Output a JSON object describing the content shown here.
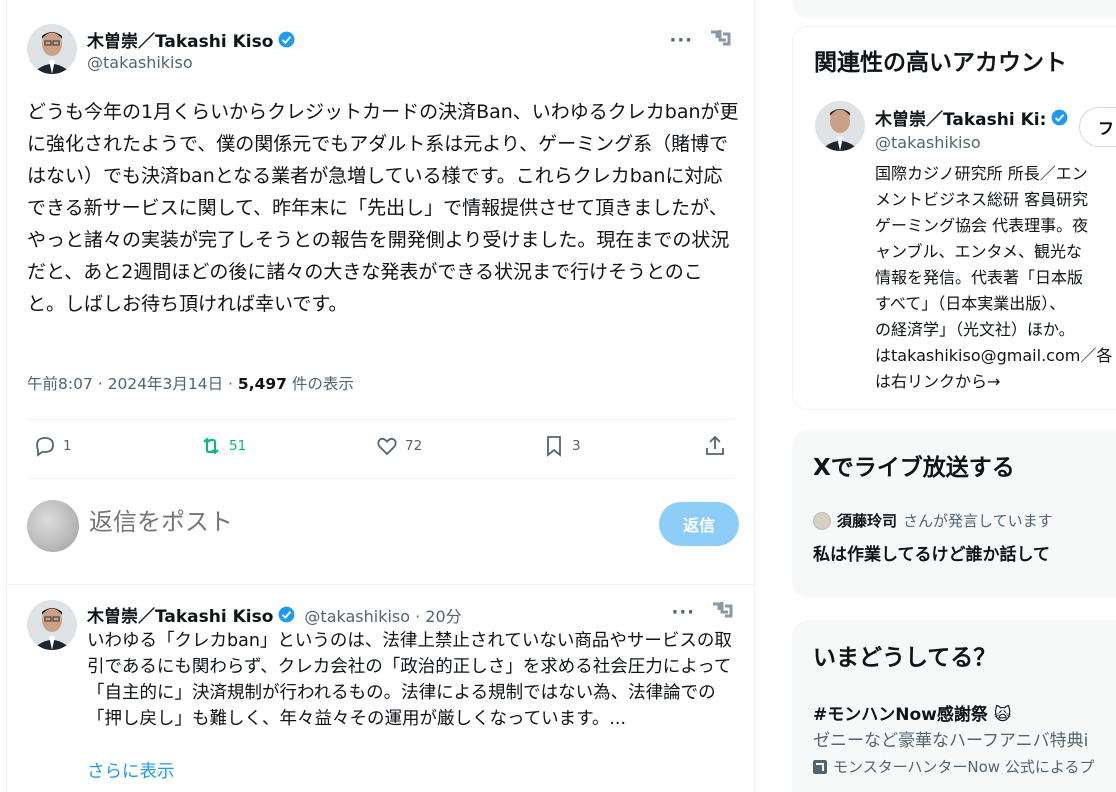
{
  "tweet": {
    "author_name": "木曽崇／Takashi Kiso",
    "handle": "@takashikiso",
    "text": "どうも今年の1月くらいからクレジットカードの決済Ban、いわゆるクレカbanが更に強化されたようで、僕の関係元でもアダルト系は元より、ゲーミング系（賭博ではない）でも決済banとなる業者が急増している様です。これらクレカbanに対応できる新サービスに関して、昨年末に「先出し」で情報提供させて頂きましたが、やっと諸々の実装が完了しそうとの報告を開発側より受けました。現在までの状況だと、あと2週間ほどの後に諸々の大きな発表ができる状況まで行けそうとのこと。しばしお待ち頂ければ幸いです。",
    "timestamp": "午前8:07 · 2024年3月14日 · ",
    "views_count": "5,497",
    "views_label": " 件の表示",
    "replies": "1",
    "retweets": "51",
    "likes": "72",
    "bookmarks": "3"
  },
  "reply_composer": {
    "placeholder": "返信をポスト",
    "button_label": "返信"
  },
  "reply_tweet": {
    "author_name": "木曽崇／Takashi Kiso",
    "handle_time": "@takashikiso · 20分",
    "text": "いわゆる「クレカban」というのは、法律上禁止されていない商品やサービスの取引であるにも関わらず、クレカ会社の「政治的正しさ」を求める社会圧力によって「自主的に」決済規制が行われるもの。法律による規制ではない為、法律論での「押し戻し」も難しく、年々益々その運用が厳しくなっています。...",
    "show_more": "さらに表示"
  },
  "sidebar": {
    "related": {
      "title": "関連性の高いアカウント",
      "name": "木曽崇／Takashi Ki:",
      "handle": "@takashikiso",
      "follow_label": "フ",
      "bio": "国際カジノ研究所 所長／エン\nメントビジネス総研 客員研究\nゲーミング協会 代表理事。夜\nャンブル、エンタメ、観光な\n情報を発信。代表著「日本版\nすべて」（日本実業出版）、\nの経済学」（光文社）ほか。\nはtakashikiso@gmail.com／各\nは右リンクから→"
    },
    "live": {
      "title": "Xでライブ放送する",
      "host_name": "須藤玲司",
      "host_suffix": "さんが発言しています",
      "space_title": "私は作業してるけど誰か話して"
    },
    "trends": {
      "title": "いまどうしてる？",
      "tag": "#モンハンNow感謝祭 🙀",
      "desc": "ゼニーなど豪華なハーフアニバ特典i",
      "promo": "モンスターハンターNow 公式によるプ"
    }
  },
  "colors": {
    "accent": "#1d9bf0",
    "retweet_green": "#00ba7c",
    "secondary_text": "#536471"
  }
}
